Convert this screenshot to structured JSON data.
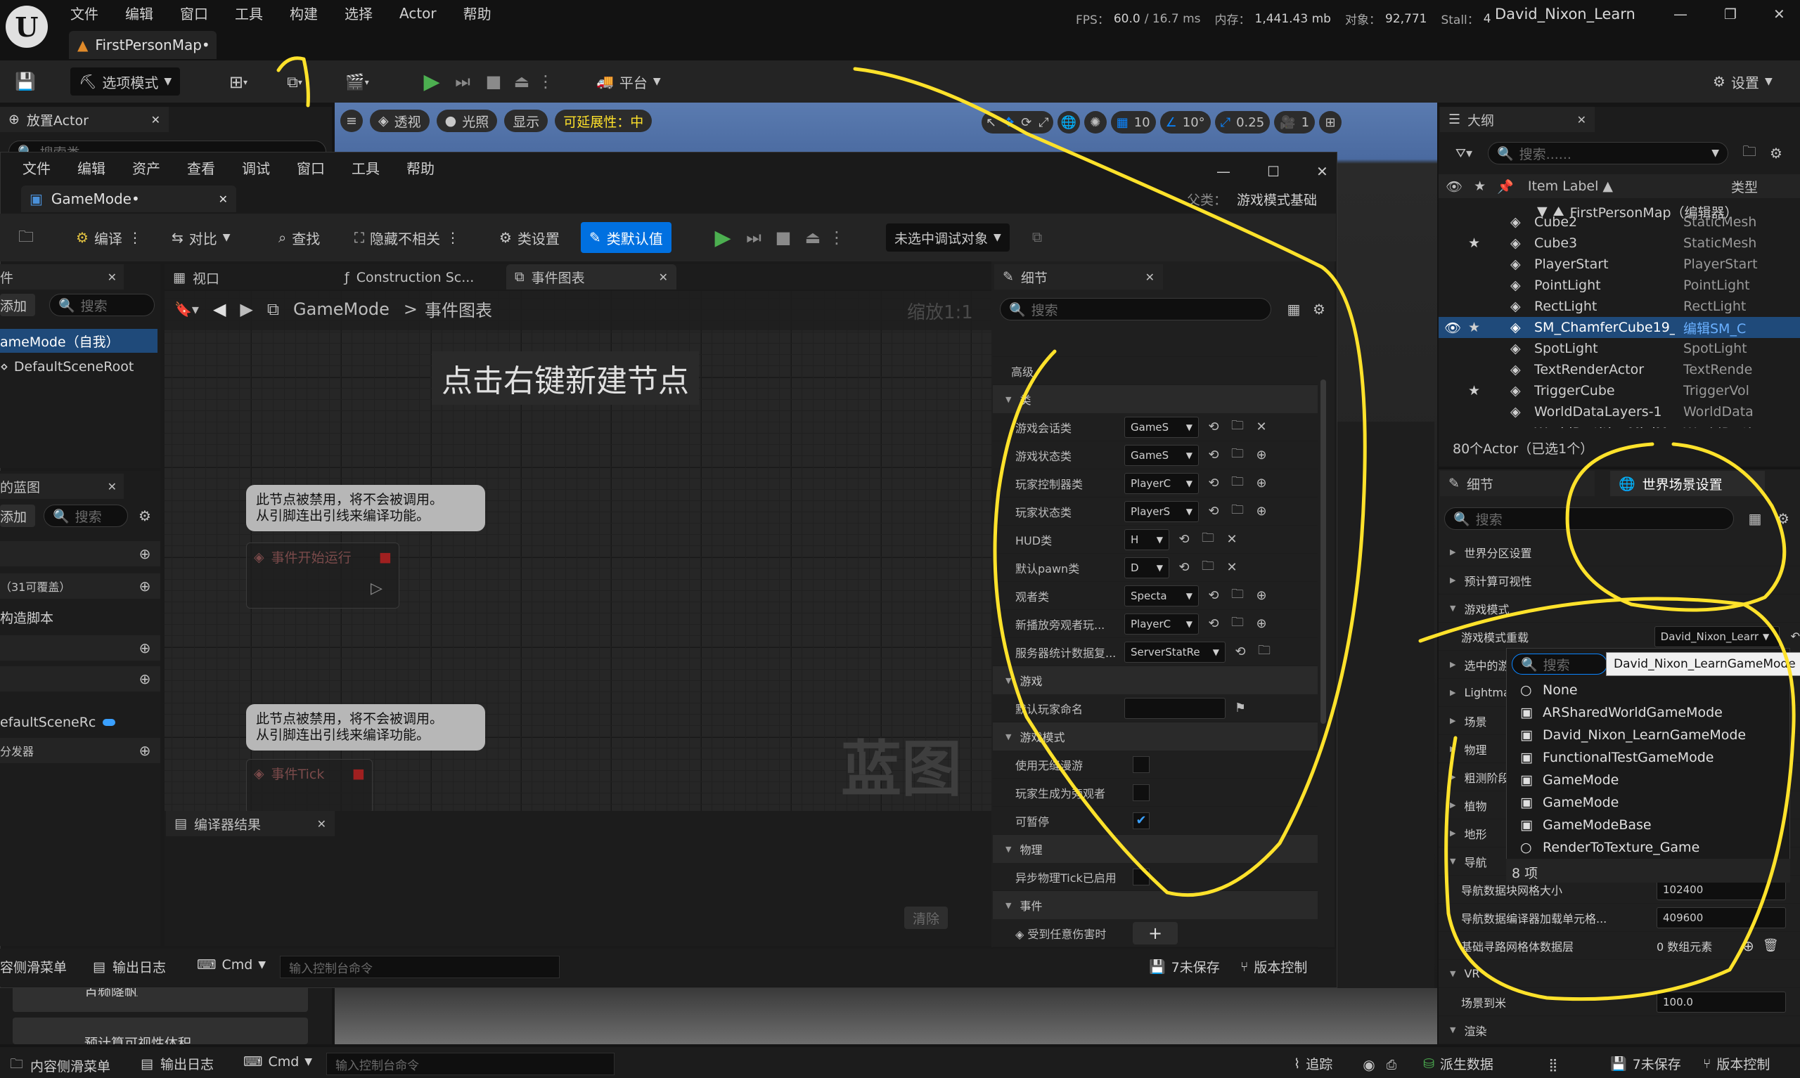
{
  "colors": {
    "accent": "#0070e0",
    "play": "#4caf50",
    "highlight": "#ffe22b",
    "selected": "#1f4a7a",
    "bg": "#151515"
  },
  "titlebar": {
    "menu": [
      "文件",
      "编辑",
      "窗口",
      "工具",
      "构建",
      "选择",
      "Actor",
      "帮助"
    ],
    "stats": {
      "fps_label": "FPS：",
      "fps": "60.0",
      "ms": "/ 16.7 ms",
      "mem_label": "内存：",
      "mem": "1,441.43 mb",
      "obj_label": "对象：",
      "obj": "92,771",
      "stall_label": "Stall：",
      "stall": "4"
    },
    "project": "David_Nixon_Learn",
    "level_tab": "FirstPersonMap•"
  },
  "toolbar": {
    "mode": "选项模式",
    "platform": "平台",
    "settings": "设置"
  },
  "place_actor": {
    "title": "放置Actor",
    "search": "搜索类"
  },
  "viewport": {
    "perspective": "透视",
    "lit": "光照",
    "show": "显示",
    "scalability": "可延展性：中",
    "grid": "10",
    "angle": "10°",
    "scale": "0.25",
    "cam": "1"
  },
  "bp": {
    "menu": [
      "文件",
      "编辑",
      "资产",
      "查看",
      "调试",
      "窗口",
      "工具",
      "帮助"
    ],
    "tab": "GameMode•",
    "parent_label": "父类：",
    "parent": "游戏模式基础",
    "toolbar": {
      "compile": "编译",
      "diff": "对比",
      "find": "查找",
      "hide": "隐藏不相关",
      "class_settings": "类设置",
      "class_defaults": "类默认值",
      "debug": "未选中调试对象"
    },
    "components": {
      "title": "件",
      "add": "添加",
      "search": "搜索",
      "root": "ameMode（自我）",
      "scene_root": "DefaultSceneRoot"
    },
    "my_bp": {
      "title": "的蓝图",
      "add": "添加",
      "search": "搜索",
      "overridable": "（31可覆盖）",
      "construction": "构造脚本",
      "var": "efaultSceneRc",
      "dispatchers": "分发器"
    },
    "graph_tabs": [
      "视口",
      "Construction Sc...",
      "事件图表"
    ],
    "breadcrumb": {
      "root": "GameMode",
      "sep": ">",
      "page": "事件图表",
      "zoom": "缩放1:1"
    },
    "hint": "点击右键新建节点",
    "comment1": "此节点被禁用，将不会被调用。\n从引脚连出引线来编译功能。",
    "node1": "事件开始运行",
    "comment2": "此节点被禁用，将不会被调用。\n从引脚连出引线来编译功能。",
    "node2": "事件Tick",
    "watermark": "蓝图",
    "compiler": {
      "title": "编译器结果",
      "clear": "清除"
    },
    "bottom": {
      "drawer": "容侧滑菜单",
      "log": "输出日志",
      "cmd": "Cmd",
      "console": "输入控制台命令",
      "unsaved": "7未保存",
      "vcs": "版本控制"
    }
  },
  "bp_details": {
    "title": "细节",
    "search": "搜索",
    "advanced": "高级",
    "class_section": "类",
    "classes": [
      {
        "label": "游戏会话类",
        "value": "GameS",
        "act": "✕"
      },
      {
        "label": "游戏状态类",
        "value": "GameS",
        "act": "⊕"
      },
      {
        "label": "玩家控制器类",
        "value": "PlayerC",
        "act": "⊕"
      },
      {
        "label": "玩家状态类",
        "value": "PlayerS",
        "act": "⊕"
      },
      {
        "label": "HUD类",
        "value": "H",
        "act": "✕"
      },
      {
        "label": "默认pawn类",
        "value": "D",
        "act": "✕"
      },
      {
        "label": "观者类",
        "value": "Specta",
        "act": "⊕"
      },
      {
        "label": "新播放旁观者玩...",
        "value": "PlayerC",
        "act": "⊕"
      },
      {
        "label": "服务器统计数据复...",
        "value": "ServerStatRe",
        "act": ""
      }
    ],
    "game_section": "游戏",
    "default_player": "默认玩家命名",
    "gamemode_section": "游戏模式",
    "seamless": "使用无缝漫游",
    "spectator": "玩家生成为旁观者",
    "pausable": "可暂停",
    "physics_section": "物理",
    "async_tick": "异步物理Tick已启用",
    "events_section": "事件",
    "on_damage": "受到任意伤害时"
  },
  "outliner": {
    "title": "大纲",
    "search": "搜索......",
    "col_label": "Item Label ▲",
    "col_type": "类型",
    "map": "FirstPersonMap（编辑器）",
    "rows": [
      {
        "name": "Cube2",
        "type": "StaticMesh",
        "star": false
      },
      {
        "name": "Cube3",
        "type": "StaticMesh",
        "star": true
      },
      {
        "name": "PlayerStart",
        "type": "PlayerStart",
        "star": false
      },
      {
        "name": "PointLight",
        "type": "PointLight",
        "star": false
      },
      {
        "name": "RectLight",
        "type": "RectLight",
        "star": false
      },
      {
        "name": "SM_ChamferCube19_",
        "type": "编辑SM_C",
        "star": true,
        "selected": true
      },
      {
        "name": "SpotLight",
        "type": "SpotLight",
        "star": false
      },
      {
        "name": "TextRenderActor",
        "type": "TextRende",
        "star": false
      },
      {
        "name": "TriggerCube",
        "type": "TriggerVol",
        "star": true
      },
      {
        "name": "WorldDataLayers-1",
        "type": "WorldData",
        "star": false
      },
      {
        "name": "WorldPartitionMiniM",
        "type": "WorldParti",
        "star": false
      }
    ],
    "count": "80个Actor（已选1个）"
  },
  "world_details": {
    "title": "细节",
    "world_settings": "世界场景设置",
    "search": "搜索",
    "sections": [
      "世界分区设置",
      "预计算可视性",
      "游戏模式"
    ],
    "gm_override_label": "游戏模式重载",
    "gm_override_value": "David_Nixon_Learr",
    "selected_label": "选中的游",
    "more_sections": [
      "Lightma",
      "场景",
      "物理",
      "粗测阶段",
      "植物",
      "地形",
      "导航"
    ],
    "nav_chunk_label": "导航数据块网格大小",
    "nav_chunk": "102400",
    "nav_loader_label": "导航数据编译器加载单元格...",
    "nav_loader": "409600",
    "nav_base_label": "基础寻路网格体数据层",
    "nav_base": "0 数组元素",
    "vr": "VR",
    "world_to_meters_label": "场景到米",
    "world_to_meters": "100.0",
    "render": "渲染"
  },
  "gm_dropdown": {
    "search": "搜索",
    "tooltip": "David_Nixon_LearnGameMode",
    "items": [
      "None",
      "ARSharedWorldGameMode",
      "David_Nixon_LearnGameMode",
      "FunctionalTestGameMode",
      "GameMode",
      "GameMode",
      "GameModeBase",
      "RenderToTexture_Game"
    ],
    "count": "8 项"
  },
  "content_drawer": {
    "item1": "百频降帆",
    "item2": "预计算可视性体积"
  },
  "statusbar": {
    "drawer": "内容侧滑菜单",
    "log": "输出日志",
    "cmd": "Cmd",
    "console": "输入控制台命令",
    "trace": "追踪",
    "derived": "派生数据",
    "unsaved": "7未保存",
    "vcs": "版本控制"
  }
}
